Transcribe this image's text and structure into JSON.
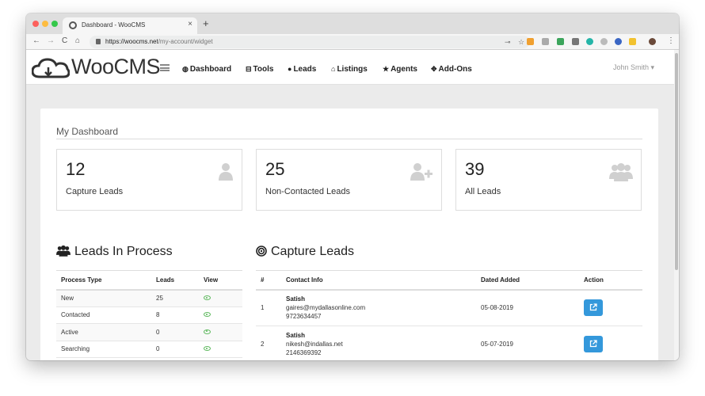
{
  "browser": {
    "tab_title": "Dashboard - WooCMS",
    "tab_close": "×",
    "new_tab": "+",
    "url_host": "https://woocms.net",
    "url_path": "/my-account/widget",
    "back": "←",
    "forward": "→",
    "reload": "C",
    "home": "⌂",
    "key_glyph": "⊸",
    "star_glyph": "☆",
    "menu_glyph": "⋮"
  },
  "site": {
    "logo_text": "WooCMS",
    "nav": [
      {
        "label": "Dashboard",
        "icon": "globe-icon",
        "glyph": "◍"
      },
      {
        "label": "Tools",
        "icon": "car-icon",
        "glyph": "⊟"
      },
      {
        "label": "Leads",
        "icon": "user-icon",
        "glyph": "●"
      },
      {
        "label": "Listings",
        "icon": "home-icon",
        "glyph": "⌂"
      },
      {
        "label": "Agents",
        "icon": "star-icon",
        "glyph": "★"
      },
      {
        "label": "Add-Ons",
        "icon": "puzzle-icon",
        "glyph": "✥"
      }
    ],
    "user_name": "John Smith ▾"
  },
  "dashboard": {
    "title": "My Dashboard",
    "stats": [
      {
        "value": "12",
        "label": "Capture Leads",
        "icon": "user-icon"
      },
      {
        "value": "25",
        "label": "Non-Contacted Leads",
        "icon": "user-plus-icon"
      },
      {
        "value": "39",
        "label": "All Leads",
        "icon": "users-icon"
      }
    ]
  },
  "leads_in_process": {
    "title": "Leads In Process",
    "headers": [
      "Process Type",
      "Leads",
      "View"
    ],
    "rows": [
      {
        "type": "New",
        "count": "25"
      },
      {
        "type": "Contacted",
        "count": "8"
      },
      {
        "type": "Active",
        "count": "0"
      },
      {
        "type": "Searching",
        "count": "0"
      }
    ]
  },
  "capture_leads": {
    "title": "Capture Leads",
    "headers": [
      "#",
      "Contact Info",
      "Dated Added",
      "Action"
    ],
    "rows": [
      {
        "num": "1",
        "name": "Satish",
        "email": "gaires@mydallasonline.com",
        "phone": "9723634457",
        "date": "05-08-2019"
      },
      {
        "num": "2",
        "name": "Satish",
        "email": "nikesh@indallas.net",
        "phone": "2146369392",
        "date": "05-07-2019"
      }
    ]
  },
  "colors": {
    "accent_button": "#3498db",
    "view_icon": "#5cb85c",
    "stat_icon": "#d0d0d0"
  }
}
